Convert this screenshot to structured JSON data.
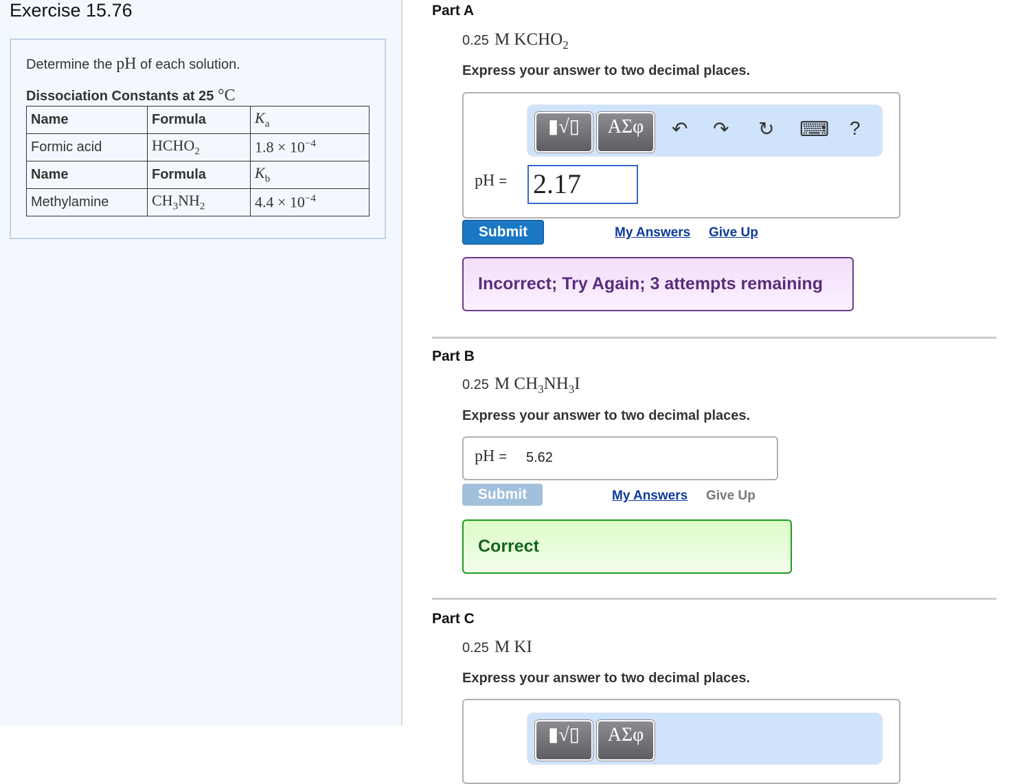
{
  "exercise": {
    "title": "Exercise 15.76"
  },
  "problem": {
    "intro_before": "Determine the",
    "intro_math": "pH",
    "intro_after": "of each solution.",
    "table_title": "Dissociation Constants at 25",
    "table_title_unit": "°C",
    "rows": [
      {
        "c1": "Name",
        "c2": "Formula",
        "c3": "K",
        "c3sub": "a",
        "header": true
      },
      {
        "c1": "Formic acid",
        "c2": "HCHO",
        "c2sub": "2",
        "c3": "1.8 × 10",
        "c3sup": "−4"
      },
      {
        "c1": "Name",
        "c2": "Formula",
        "c3": "K",
        "c3sub": "b",
        "header": true
      },
      {
        "c1": "Methylamine",
        "c2": "CH",
        "c2sub": "3",
        "c2b": "NH",
        "c2bsub": "2",
        "c3": "4.4 × 10",
        "c3sup": "−4"
      }
    ]
  },
  "toolbar": {
    "templates": "▮√▯",
    "greek": "ΑΣφ",
    "undo": "↶",
    "redo": "↷",
    "reset": "↻",
    "keyboard": "⌨",
    "help": "?"
  },
  "common": {
    "instruction": "Express your answer to two decimal places.",
    "ph_label": "pH",
    "equals": "=",
    "submit": "Submit",
    "my_answers": "My Answers",
    "give_up": "Give Up"
  },
  "parts": [
    {
      "title": "Part A",
      "conc": "0.25",
      "formula": "M KCHO",
      "formula_sub": "2",
      "answer": "2.17",
      "feedback": "Incorrect; Try Again; 3 attempts remaining"
    },
    {
      "title": "Part B",
      "conc": "0.25",
      "formula": "M CH",
      "formula_sub": "3",
      "formula_b": "NH",
      "formula_b_sub": "3",
      "formula_c": "I",
      "answer": "5.62",
      "feedback": "Correct"
    },
    {
      "title": "Part C",
      "conc": "0.25",
      "formula": "M KI"
    }
  ],
  "colors": {
    "submit_active": "#1b78c4",
    "submit_disabled": "#a0c0dc",
    "incorrect_text": "#5a2d7a",
    "correct_text": "#12661a"
  }
}
